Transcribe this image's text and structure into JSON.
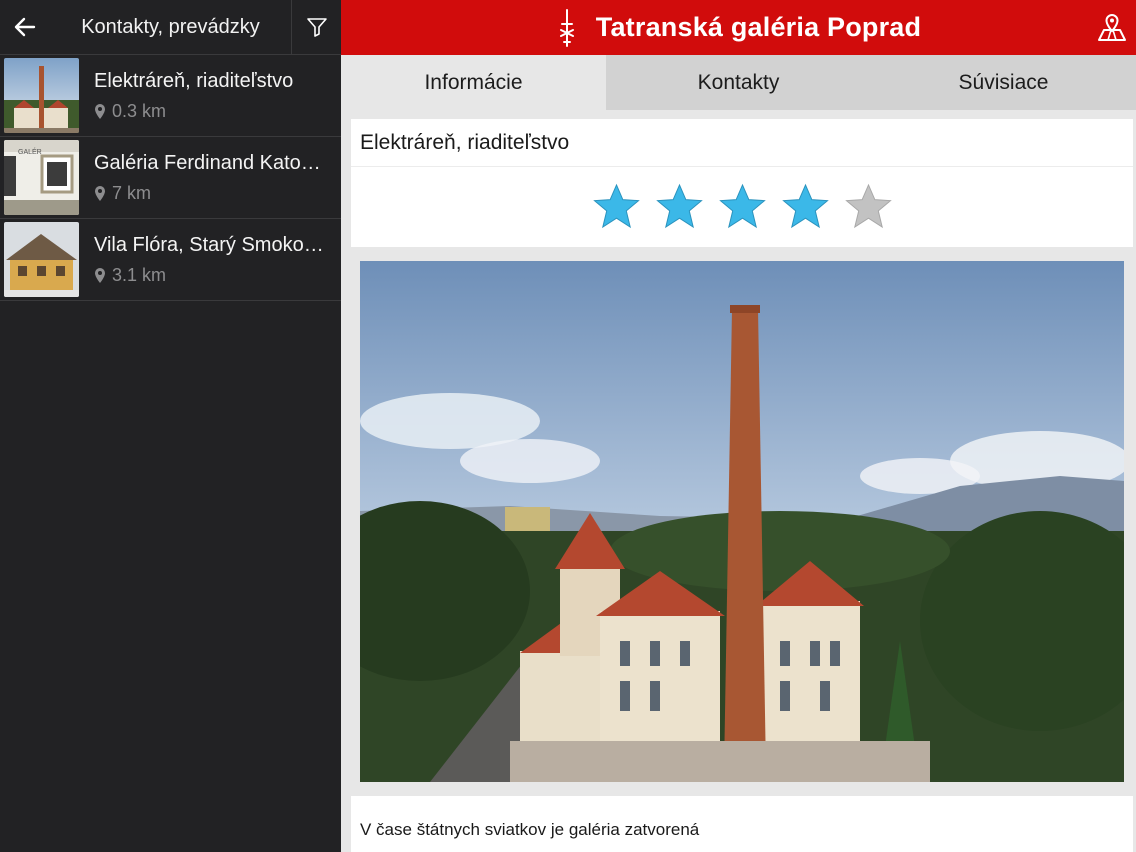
{
  "left_panel": {
    "title": "Kontakty, prevádzky",
    "items": [
      {
        "name": "Elektráreň, riaditeľstvo",
        "distance": "0.3 km"
      },
      {
        "name": "Galéria Ferdinand Katona, Spišská Sobota",
        "distance": "7 km"
      },
      {
        "name": "Vila Flóra, Starý Smokovec",
        "distance": "3.1 km"
      }
    ]
  },
  "header": {
    "title": "Tatranská galéria Poprad"
  },
  "tabs": [
    {
      "label": "Informácie",
      "active": true
    },
    {
      "label": "Kontakty",
      "active": false
    },
    {
      "label": "Súvisiace",
      "active": false
    }
  ],
  "detail": {
    "title": "Elektráreň, riaditeľstvo",
    "rating": 4,
    "rating_max": 5,
    "note": "V čase štátnych sviatkov je galéria zatvorená"
  },
  "colors": {
    "brand_red": "#d10c0c",
    "star_filled": "#3bb8e8",
    "star_empty": "#c2c2c2",
    "panel_dark": "#222224"
  },
  "icons": {
    "back": "arrow-left-icon",
    "filter": "filter-icon",
    "location": "map-pin-icon",
    "map": "map-location-icon"
  }
}
